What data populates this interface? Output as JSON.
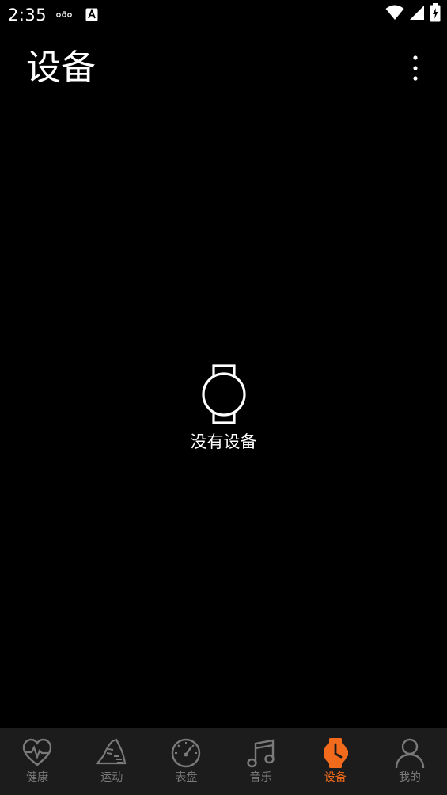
{
  "status_bar": {
    "time": "2:35",
    "notification_icons": [
      "location-icon",
      "keyboard-a-icon"
    ],
    "system_icons": [
      "wifi-icon",
      "cell-signal-icon",
      "battery-charging-icon"
    ]
  },
  "app_bar": {
    "title": "设备",
    "menu_icon": "more-vertical-icon"
  },
  "empty_state": {
    "icon": "watch-icon",
    "message": "没有设备"
  },
  "bottom_nav": {
    "items": [
      {
        "label": "健康",
        "icon": "heart-pulse-icon",
        "active": false
      },
      {
        "label": "运动",
        "icon": "running-shoe-icon",
        "active": false
      },
      {
        "label": "表盘",
        "icon": "dial-icon",
        "active": false
      },
      {
        "label": "音乐",
        "icon": "music-note-icon",
        "active": false
      },
      {
        "label": "设备",
        "icon": "watch-icon",
        "active": true
      },
      {
        "label": "我的",
        "icon": "person-icon",
        "active": false
      }
    ],
    "active_color": "#f26a1b",
    "inactive_color": "#7a7a7a",
    "background": "#1c1c1c"
  }
}
